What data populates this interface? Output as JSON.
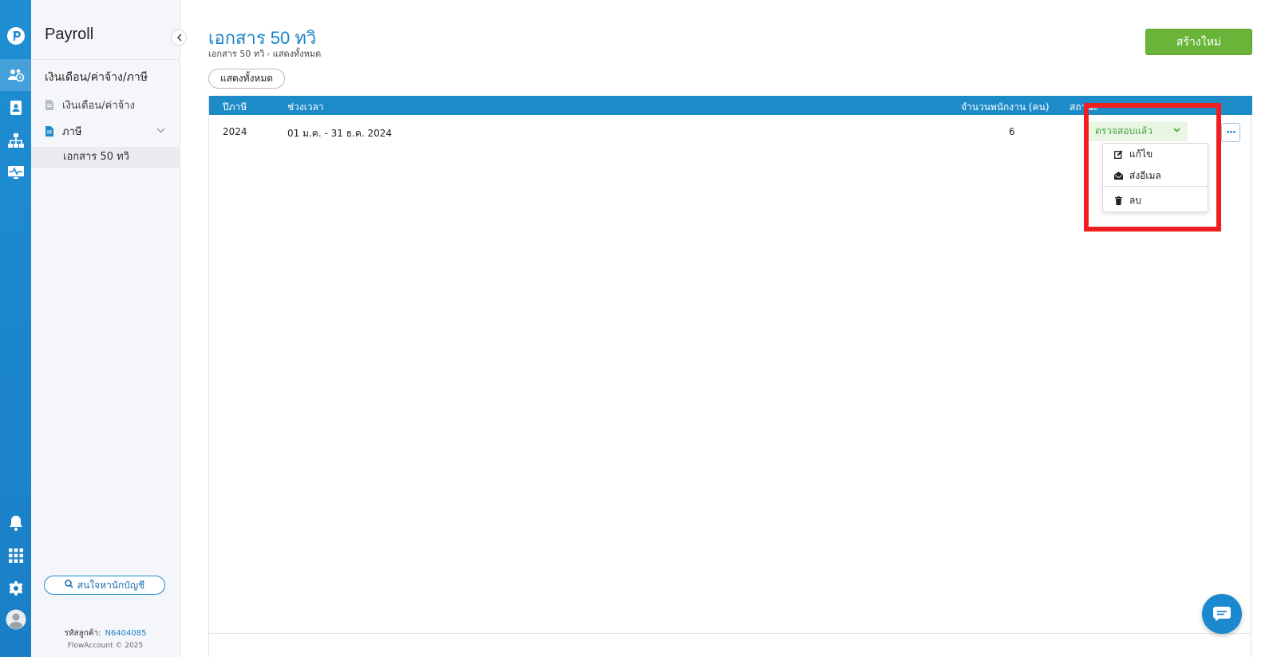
{
  "app": {
    "title": "Payroll"
  },
  "sidebar": {
    "section_title": "เงินเดือน/ค่าจ้าง/ภาษี",
    "items": [
      {
        "label": "เงินเดือน/ค่าจ้าง",
        "icon": "document-icon"
      },
      {
        "label": "ภาษี",
        "icon": "document-icon",
        "expanded": true
      }
    ],
    "sub_items": [
      {
        "label": "เอกสาร 50 ทวิ",
        "active": true
      }
    ],
    "find_accountant_label": "สนใจหานักบัญชี",
    "customer_code_label": "รหัสลูกค้า:",
    "customer_code": "N6404085",
    "copyright": "FlowAccount © 2025"
  },
  "page": {
    "title": "เอกสาร 50 ทวิ",
    "breadcrumb": [
      "เอกสาร 50 ทวิ",
      "แสดงทั้งหมด"
    ],
    "create_button": "สร้างใหม่",
    "filter_label": "แสดงทั้งหมด"
  },
  "table": {
    "headers": [
      "ปีภาษี",
      "ช่วงเวลา",
      "จำนวนพนักงาน (คน)",
      "สถานะ"
    ],
    "rows": [
      {
        "tax_year": "2024",
        "period": "01 ม.ค. - 31 ธ.ค. 2024",
        "employees": "6",
        "status": "ตรวจสอบแล้ว"
      }
    ]
  },
  "row_menu": {
    "items": [
      {
        "label": "แก้ไข",
        "icon": "edit-icon"
      },
      {
        "label": "ส่งอีเมล",
        "icon": "email-icon"
      },
      {
        "label": "ลบ",
        "icon": "trash-icon"
      }
    ]
  },
  "colors": {
    "primary": "#1e8bc9",
    "success": "#6ab539",
    "status_text": "#48a343",
    "highlight": "#f01e1e"
  }
}
